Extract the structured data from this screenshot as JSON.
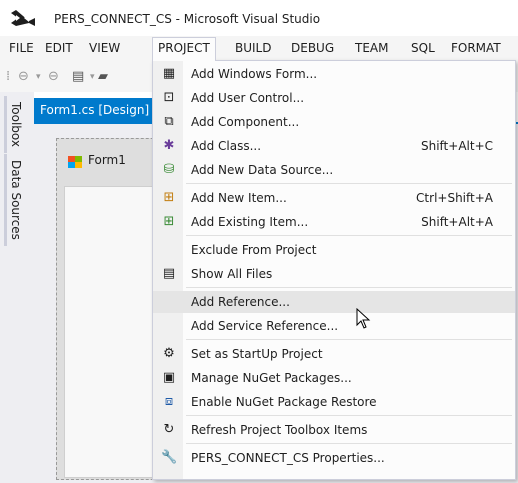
{
  "window": {
    "title": "PERS_CONNECT_CS - Microsoft Visual Studio"
  },
  "menubar": {
    "items": [
      "FILE",
      "EDIT",
      "VIEW",
      "PROJECT",
      "BUILD",
      "DEBUG",
      "TEAM",
      "SQL",
      "FORMAT"
    ],
    "active": "PROJECT"
  },
  "side_tabs": [
    "Toolbox",
    "Data Sources"
  ],
  "document_tab": {
    "label": "Form1.cs [Design]"
  },
  "designer": {
    "form_title": "Form1"
  },
  "project_menu": {
    "items": [
      {
        "label": "Add Windows Form...",
        "shortcut": "",
        "icon": "windows-form-icon"
      },
      {
        "label": "Add User Control...",
        "shortcut": "",
        "icon": "user-control-icon"
      },
      {
        "label": "Add Component...",
        "shortcut": "",
        "icon": "component-icon"
      },
      {
        "label": "Add Class...",
        "shortcut": "Shift+Alt+C",
        "icon": "class-icon"
      },
      {
        "label": "Add New Data Source...",
        "shortcut": "",
        "icon": "data-source-icon"
      },
      {
        "label": "Add New Item...",
        "shortcut": "Ctrl+Shift+A",
        "icon": "new-item-icon"
      },
      {
        "label": "Add Existing Item...",
        "shortcut": "Shift+Alt+A",
        "icon": "existing-item-icon"
      },
      {
        "label": "Exclude From Project",
        "shortcut": "",
        "icon": ""
      },
      {
        "label": "Show All Files",
        "shortcut": "",
        "icon": "show-all-files-icon"
      },
      {
        "label": "Add Reference...",
        "shortcut": "",
        "icon": "",
        "highlighted": true
      },
      {
        "label": "Add Service Reference...",
        "shortcut": "",
        "icon": ""
      },
      {
        "label": "Set as StartUp Project",
        "shortcut": "",
        "icon": "gear-icon"
      },
      {
        "label": "Manage NuGet Packages...",
        "shortcut": "",
        "icon": "nuget-icon"
      },
      {
        "label": "Enable NuGet Package Restore",
        "shortcut": "",
        "icon": "package-restore-icon"
      },
      {
        "label": "Refresh Project Toolbox Items",
        "shortcut": "",
        "icon": "refresh-icon"
      },
      {
        "label": "PERS_CONNECT_CS Properties...",
        "shortcut": "",
        "icon": "wrench-icon"
      }
    ]
  },
  "colors": {
    "accent": "#007acc",
    "menu_bg": "#fcfcfc",
    "hover": "#e5e5e5",
    "chrome": "#f5f5f5"
  }
}
